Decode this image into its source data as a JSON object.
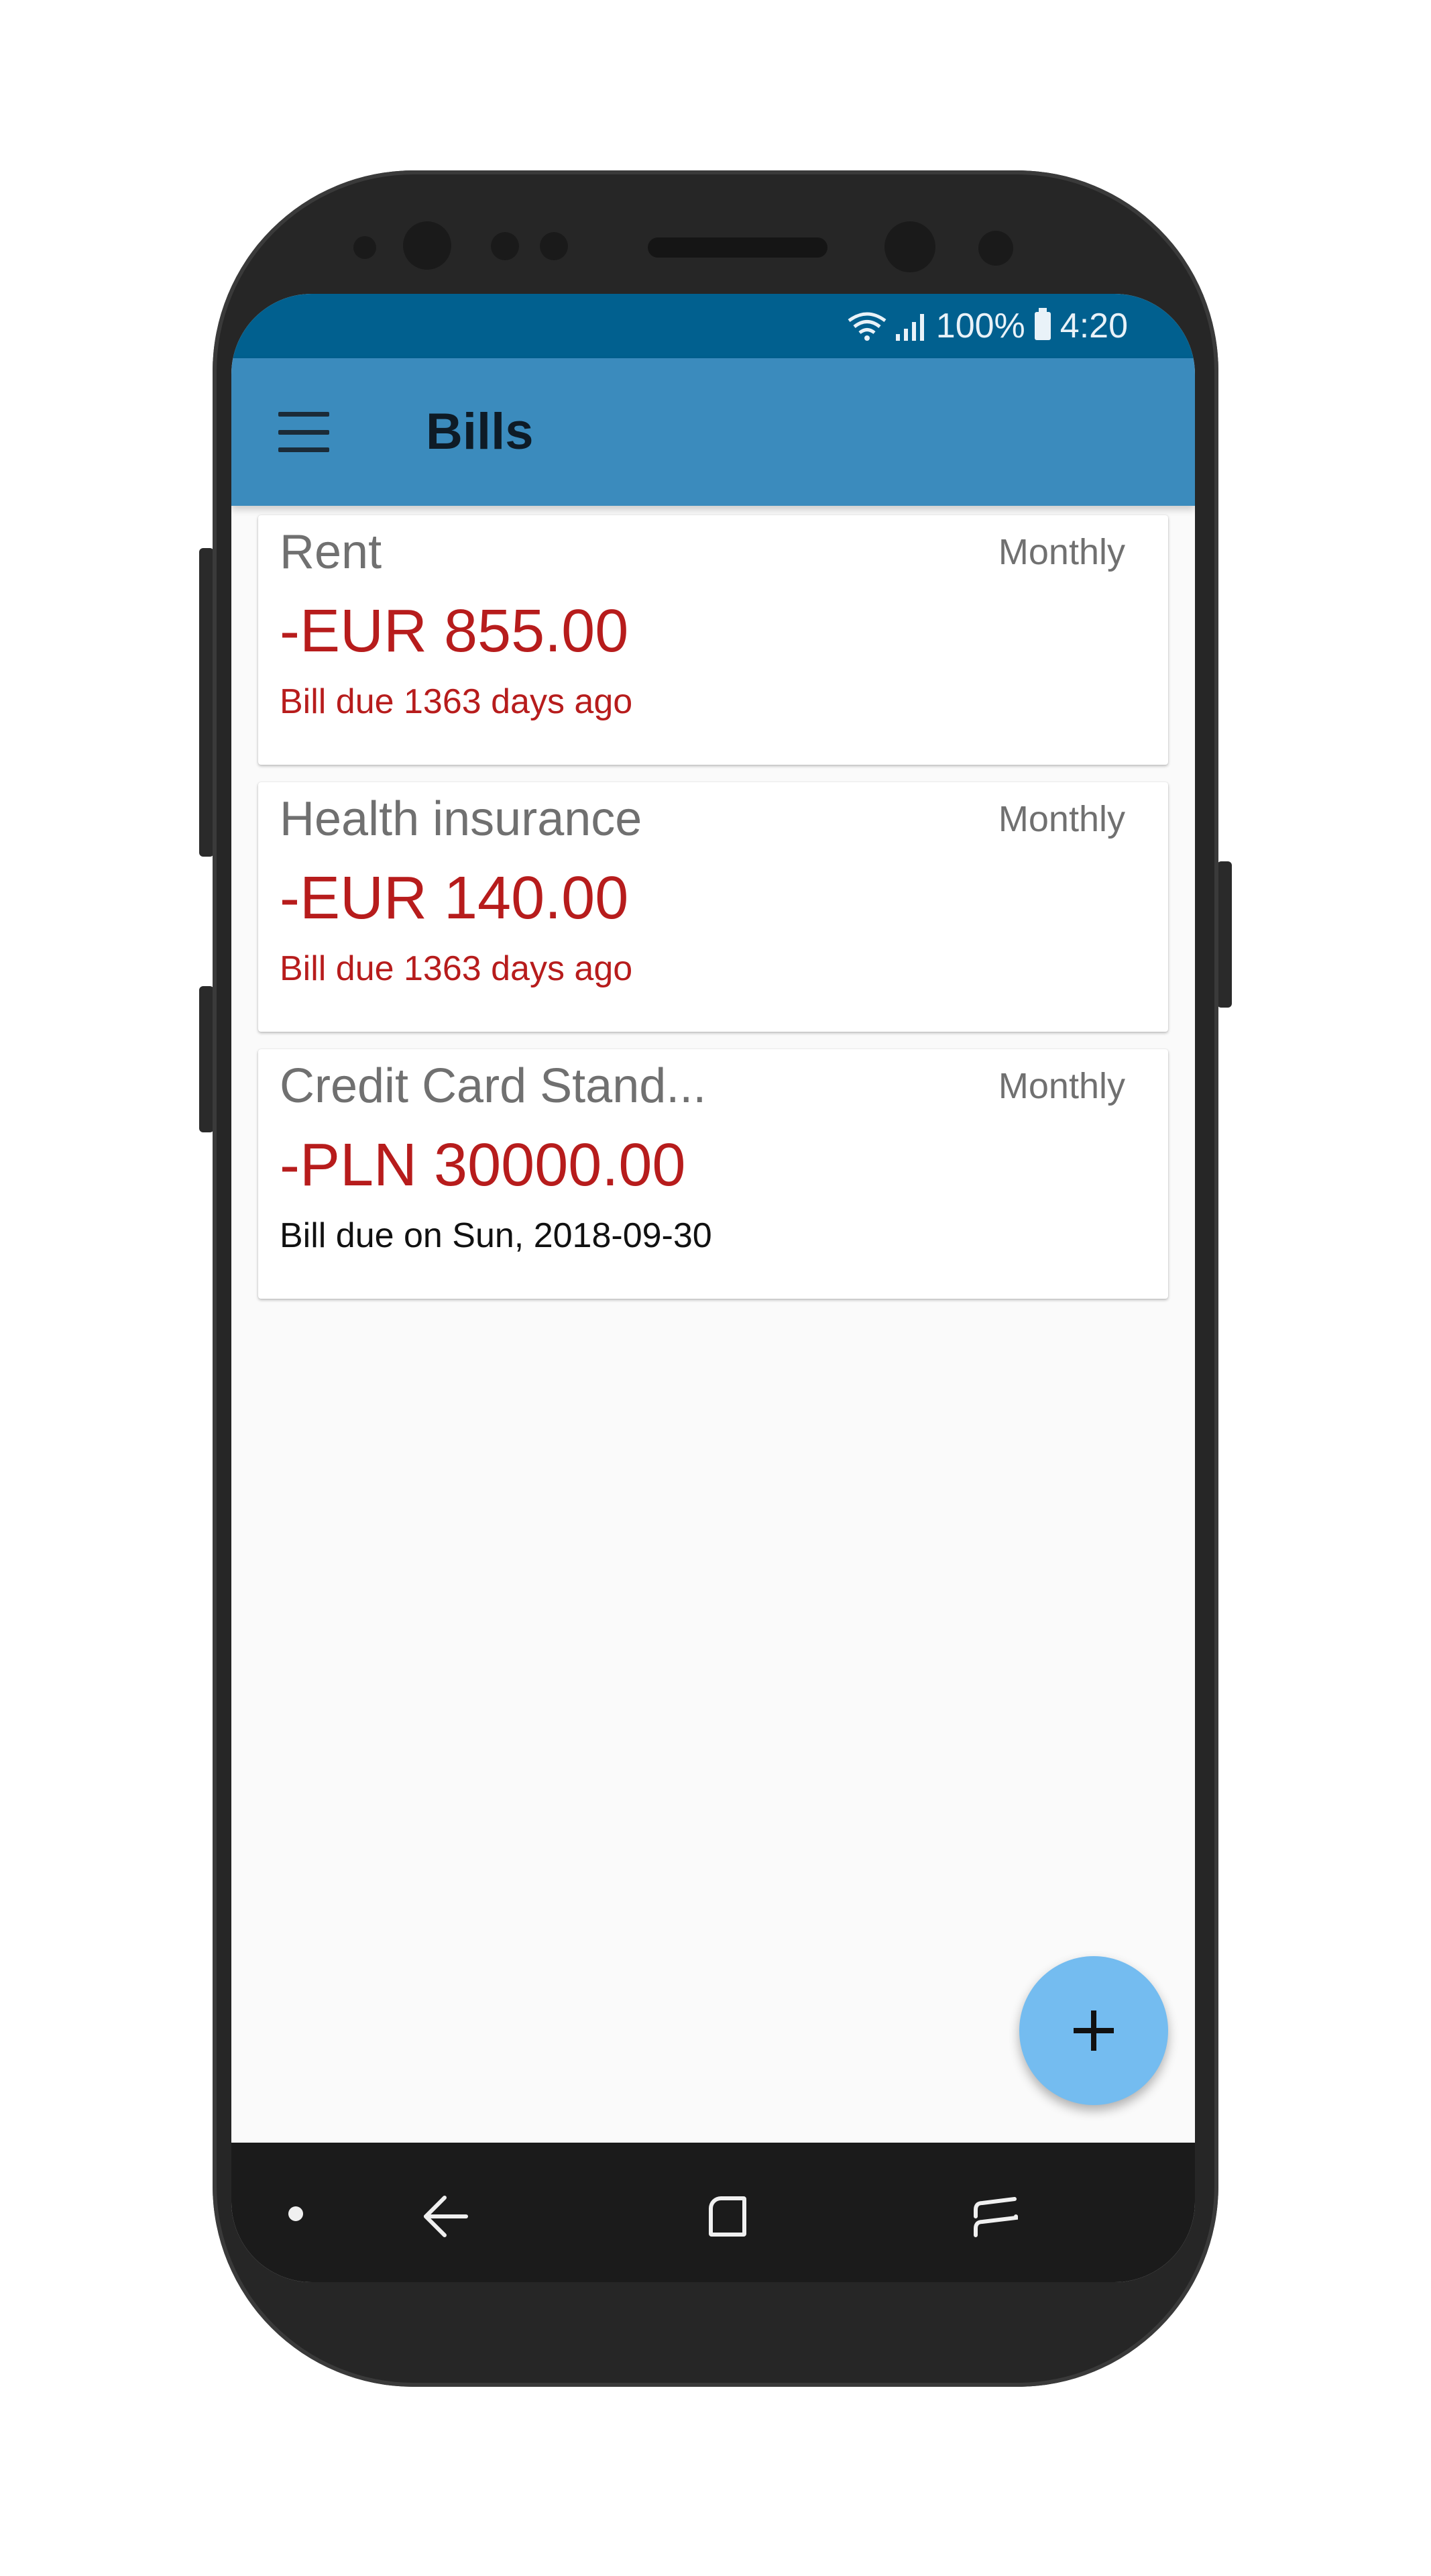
{
  "status_bar": {
    "battery_percent": "100%",
    "time": "4:20",
    "wifi_icon": "wifi-icon",
    "signal_icon": "signal-icon",
    "battery_icon": "battery-icon"
  },
  "app_bar": {
    "title": "Bills",
    "menu_icon": "hamburger-menu-icon",
    "background_color": "#3b8bbd"
  },
  "bills": [
    {
      "name": "Rent",
      "frequency": "Monthly",
      "amount": "-EUR 855.00",
      "due_text": "Bill due 1363 days ago",
      "overdue": true
    },
    {
      "name": "Health insurance",
      "frequency": "Monthly",
      "amount": "-EUR 140.00",
      "due_text": "Bill due 1363 days ago",
      "overdue": true
    },
    {
      "name": "Credit Card Stand...",
      "frequency": "Monthly",
      "amount": "-PLN 30000.00",
      "due_text": "Bill due on Sun, 2018-09-30",
      "overdue": false
    }
  ],
  "fab": {
    "icon": "plus-icon",
    "color": "#74bcf0"
  },
  "nav_bar": {
    "back_icon": "back-arrow-icon",
    "home_icon": "home-square-icon",
    "recent_icon": "recent-apps-icon"
  },
  "colors": {
    "status_bar": "#01608f",
    "overdue_red": "#b71c1c",
    "nav_bar": "#1b1b1b"
  }
}
